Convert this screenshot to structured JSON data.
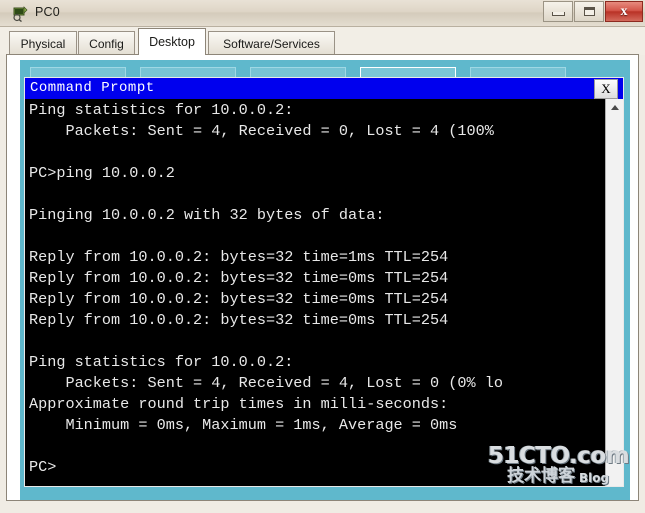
{
  "window": {
    "title": "PC0",
    "icon": "pc-device-icon",
    "controls": {
      "minimize_label": "–",
      "maximize_label": "□",
      "close_label": "x"
    }
  },
  "tabs": [
    {
      "label": "Physical",
      "active": false
    },
    {
      "label": "Config",
      "active": false
    },
    {
      "label": "Desktop",
      "active": true
    },
    {
      "label": "Software/Services",
      "active": false
    }
  ],
  "command_prompt": {
    "title": "Command Prompt",
    "close_label": "X",
    "scroll_up_icon": "arrow-up-icon",
    "lines": [
      "Ping statistics for 10.0.0.2:",
      "    Packets: Sent = 4, Received = 0, Lost = 4 (100%",
      "",
      "PC>ping 10.0.0.2",
      "",
      "Pinging 10.0.0.2 with 32 bytes of data:",
      "",
      "Reply from 10.0.0.2: bytes=32 time=1ms TTL=254",
      "Reply from 10.0.0.2: bytes=32 time=0ms TTL=254",
      "Reply from 10.0.0.2: bytes=32 time=0ms TTL=254",
      "Reply from 10.0.0.2: bytes=32 time=0ms TTL=254",
      "",
      "Ping statistics for 10.0.0.2:",
      "    Packets: Sent = 4, Received = 4, Lost = 0 (0% lo",
      "Approximate round trip times in milli-seconds:",
      "    Minimum = 0ms, Maximum = 1ms, Average = 0ms",
      "",
      "PC>"
    ],
    "text": "Ping statistics for 10.0.0.2:\n    Packets: Sent = 4, Received = 0, Lost = 4 (100%\n\nPC>ping 10.0.0.2\n\nPinging 10.0.0.2 with 32 bytes of data:\n\nReply from 10.0.0.2: bytes=32 time=1ms TTL=254\nReply from 10.0.0.2: bytes=32 time=0ms TTL=254\nReply from 10.0.0.2: bytes=32 time=0ms TTL=254\nReply from 10.0.0.2: bytes=32 time=0ms TTL=254\n\nPing statistics for 10.0.0.2:\n    Packets: Sent = 4, Received = 4, Lost = 0 (0% lo\nApproximate round trip times in milli-seconds:\n    Minimum = 0ms, Maximum = 1ms, Average = 0ms\n\nPC>"
  },
  "watermark": {
    "main": "51CTO.com",
    "chinese": "技术博客",
    "blog": "Blog"
  },
  "colors": {
    "desktop_cyan": "#5fb8cc",
    "titlebar_blue": "#0000ee",
    "terminal_bg": "#000000",
    "terminal_fg": "#e8e8e8",
    "close_red": "#b93226"
  }
}
